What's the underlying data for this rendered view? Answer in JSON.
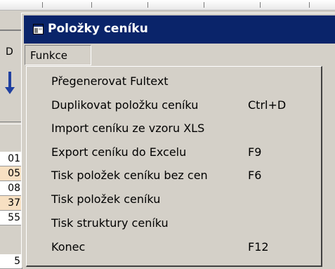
{
  "background": {
    "menu_letter": "D",
    "row_values": [
      "01",
      "05",
      "08",
      "37",
      "55",
      "5"
    ]
  },
  "window": {
    "title": "Položky ceníku"
  },
  "menubar": {
    "funkce_label": "Funkce"
  },
  "menu": {
    "items": [
      {
        "label": "Přegenerovat Fultext",
        "shortcut": ""
      },
      {
        "label": "Duplikovat položku ceníku",
        "shortcut": "Ctrl+D"
      },
      {
        "label": "Import ceníku ze vzoru XLS",
        "shortcut": ""
      },
      {
        "label": "Export ceníku do Excelu",
        "shortcut": "F9"
      },
      {
        "label": "Tisk položek ceníku bez cen",
        "shortcut": "F6"
      },
      {
        "label": "Tisk položek ceníku",
        "shortcut": ""
      },
      {
        "label": "Tisk struktury ceníku",
        "shortcut": ""
      },
      {
        "label": "Konec",
        "shortcut": "F12"
      }
    ]
  },
  "colors": {
    "titlebar": "#0a246a",
    "face": "#d4d0c8",
    "row_highlight": "#f7e0c2"
  }
}
